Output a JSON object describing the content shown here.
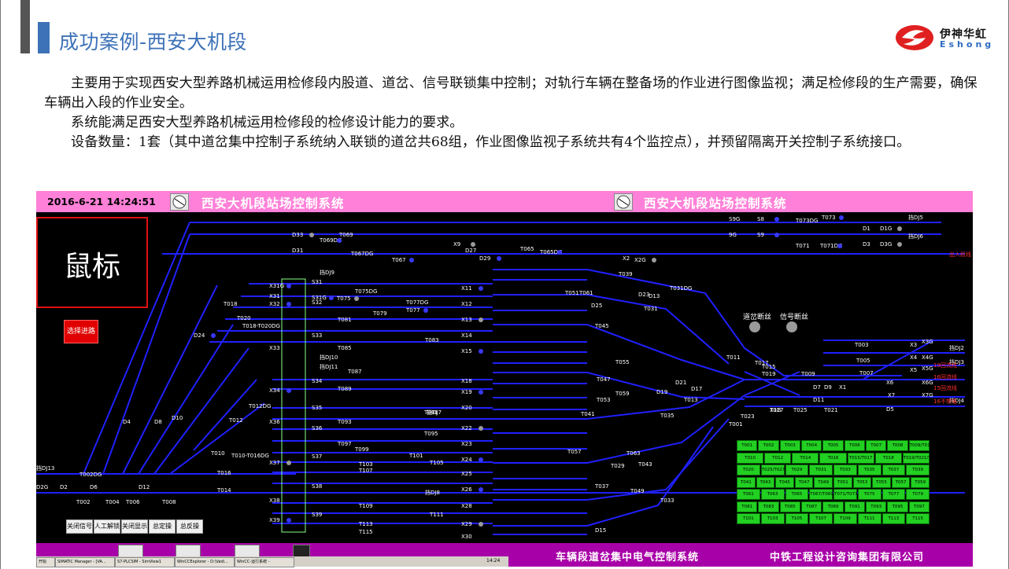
{
  "slide": {
    "title": "成功案例-西安大机段",
    "logo_cn": "伊神华虹",
    "logo_en": "Eshong",
    "paragraphs": [
      "主要用于实现西安大型养路机械运用检修段内股道、道岔、信号联锁集中控制；对轨行车辆在整备场的作业进行图像监视；满足检修段的生产需要，确保车辆出入段的作业安全。",
      "系统能满足西安大型养路机械运用检修段的检修设计能力的要求。",
      "设备数量：1套（其中道岔集中控制子系统纳入联锁的道岔共68组，作业图像监视子系统共有4个监控点），并预留隔离开关控制子系统接口。"
    ]
  },
  "scada": {
    "datetime": "2016-6-21 14:24:51",
    "system_title": "西安大机段站场控制系统",
    "mouse_label": "鼠标",
    "route_button": "选择进路",
    "control_buttons": [
      "关闭信号",
      "人工解锁",
      "关闭显示",
      "总定操",
      "总反操"
    ],
    "alarms": [
      "道岔断丝",
      "信号断丝"
    ],
    "track_labels": [
      "D33",
      "T069",
      "T069DG",
      "D31",
      "T067",
      "T067DG",
      "X9",
      "D27",
      "D29",
      "T065",
      "T065DG",
      "X2",
      "X2G",
      "S9G",
      "S8",
      "T073DG",
      "T073",
      "D1",
      "D1G",
      "9G",
      "S9",
      "T071",
      "T071DG",
      "D3",
      "D3G",
      "S31",
      "X31G",
      "X31",
      "S31G",
      "T018",
      "T075",
      "T075DG",
      "T077",
      "T077DG",
      "X11",
      "X12",
      "X13",
      "X14",
      "X15",
      "X18",
      "X19",
      "X20",
      "X22",
      "X23",
      "X24",
      "X25",
      "X26",
      "X28",
      "X29",
      "X30",
      "X32",
      "X33",
      "X34",
      "X36",
      "X37",
      "X38",
      "X39",
      "T020",
      "D24",
      "T018-T020DG",
      "S32",
      "S33",
      "S34",
      "S35",
      "S36",
      "S37",
      "S38",
      "S39",
      "T012",
      "T012DG",
      "T010",
      "T010-T016DG",
      "T016",
      "T014",
      "T008",
      "T006",
      "T004",
      "T002",
      "T002DG",
      "D2G",
      "D2",
      "D6",
      "D12",
      "D4",
      "D8",
      "D10",
      "T085",
      "T083",
      "T081",
      "T079",
      "T087",
      "T089",
      "T091",
      "T093",
      "T095",
      "T097",
      "T099",
      "T101",
      "T103",
      "T105",
      "T107",
      "T109",
      "T111",
      "T113",
      "T115",
      "T039",
      "T051",
      "T061",
      "D23",
      "D13",
      "T031",
      "T031DG",
      "D25",
      "T045",
      "T055",
      "T047",
      "T059",
      "T053",
      "T041",
      "T043",
      "T063",
      "T057",
      "T029",
      "T037",
      "T049",
      "D15",
      "T033",
      "T035",
      "D19",
      "D21",
      "D17",
      "T013",
      "T011",
      "T017",
      "T015",
      "T019",
      "T009",
      "T025",
      "T027",
      "T023",
      "T001",
      "T003",
      "T005",
      "T007",
      "X1",
      "X3",
      "X4",
      "X5",
      "X6",
      "X7",
      "D5",
      "D7",
      "D9",
      "D11",
      "T021",
      "X1G",
      "X3G",
      "X4G",
      "X5G",
      "X6G",
      "X7G"
    ],
    "dj_labels": [
      "挡DJ5",
      "挡DJ6",
      "挡DJ9",
      "挡DJ10",
      "挡DJ11",
      "挡DJ7",
      "挡DJ8",
      "挡DJ13",
      "挡DJ2",
      "挡DJ3",
      "挡DJ4"
    ],
    "right_labels": [
      "出入段线",
      "19回流线",
      "16回流线",
      "15回流线",
      "16不带电"
    ],
    "green_panel": [
      [
        "T001",
        "T002",
        "T003",
        "T004",
        "T005",
        "T006",
        "T007",
        "T008",
        "T009/T011/T013"
      ],
      [
        "T010",
        "T012",
        "T014",
        "T016",
        "T015/T017",
        "T018",
        "T019/T021/T023"
      ],
      [
        "T020",
        "T025/T027",
        "T029",
        "T031",
        "T033",
        "T035",
        "T037",
        "T039"
      ],
      [
        "T041",
        "T043",
        "T045",
        "T047",
        "T049",
        "T051",
        "T053",
        "T055",
        "T057",
        "T059"
      ],
      [
        "T061",
        "T063",
        "T065",
        "T067/T069",
        "T071/T073",
        "T075",
        "T077",
        "T079"
      ],
      [
        "T081",
        "T083",
        "T085",
        "T087",
        "T089",
        "T091",
        "T093",
        "T095",
        "T097"
      ],
      [
        "T101",
        "T103",
        "T105",
        "T107",
        "T109",
        "T111",
        "T113",
        "T115"
      ]
    ],
    "footer_left": "车辆段道岔集中电气控制系统",
    "footer_right": "中铁工程设计咨询集团有限公司"
  },
  "taskbar": {
    "items": [
      "开始",
      "SIMATIC Manager - [VA...",
      "S7-PLCSIM - SimView1",
      "WinCCExplorer - D:\\Vadi...",
      "WinCC-运行系统 -"
    ],
    "clock": "14:24"
  },
  "colors": {
    "title_blue": "#3d72b8",
    "track_blue": "#2020ff",
    "topbar_pink": "#ff80d8",
    "footer_purple": "#a800a8",
    "panel_green": "#22d022"
  }
}
